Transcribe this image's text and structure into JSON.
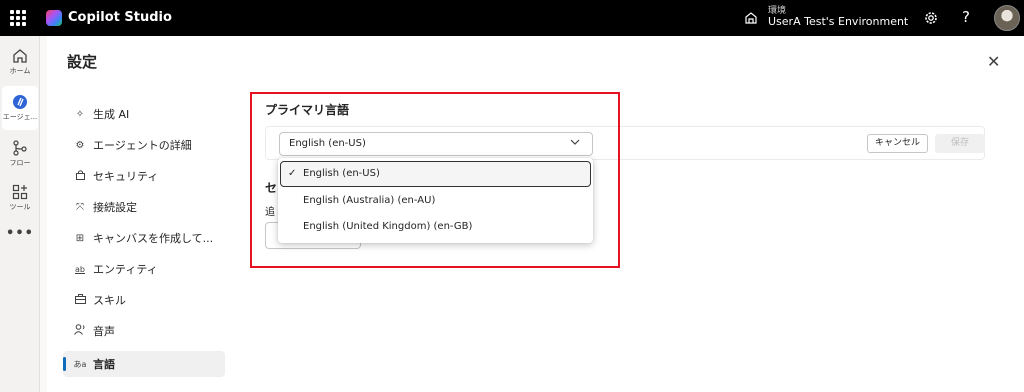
{
  "app": {
    "title": "Copilot Studio"
  },
  "environment": {
    "label": "環境",
    "name": "UserA Test's Environment"
  },
  "topbar": {
    "help_glyph": "?"
  },
  "rail": {
    "items": [
      {
        "label": "ホーム",
        "icon": "home-icon"
      },
      {
        "label": "エージェ...",
        "icon": "agent-icon"
      },
      {
        "label": "フロー",
        "icon": "flow-icon"
      },
      {
        "label": "ツール",
        "icon": "tools-icon"
      }
    ],
    "more": "•••"
  },
  "settings": {
    "title": "設定",
    "close_glyph": "✕",
    "nav": [
      {
        "label": "生成 AI",
        "icon": "sparkle-icon"
      },
      {
        "label": "エージェントの詳細",
        "icon": "gear-icon"
      },
      {
        "label": "セキュリティ",
        "icon": "lock-icon"
      },
      {
        "label": "接続設定",
        "icon": "connection-icon"
      },
      {
        "label": "キャンバスを作成して...",
        "icon": "canvas-icon"
      },
      {
        "label": "エンティティ",
        "icon": "entity-icon"
      },
      {
        "label": "スキル",
        "icon": "briefcase-icon"
      },
      {
        "label": "音声",
        "icon": "voice-icon"
      },
      {
        "label": "言語",
        "icon": "language-icon",
        "selected": true
      }
    ]
  },
  "language": {
    "section_title": "プライマリ言語",
    "selected_value": "English (en-US)",
    "cancel_label": "キャンセル",
    "save_label": "保存",
    "options": [
      {
        "label": "English (en-US)",
        "selected": true
      },
      {
        "label": "English (Australia) (en-AU)",
        "selected": false
      },
      {
        "label": "English (United Kingdom) (en-GB)",
        "selected": false
      }
    ],
    "secondary_title_partial": "セ",
    "secondary_text_partial": "追"
  },
  "colors": {
    "accent": "#0f6cbd",
    "highlight_border": "#e81123",
    "topbar": "#000000"
  }
}
